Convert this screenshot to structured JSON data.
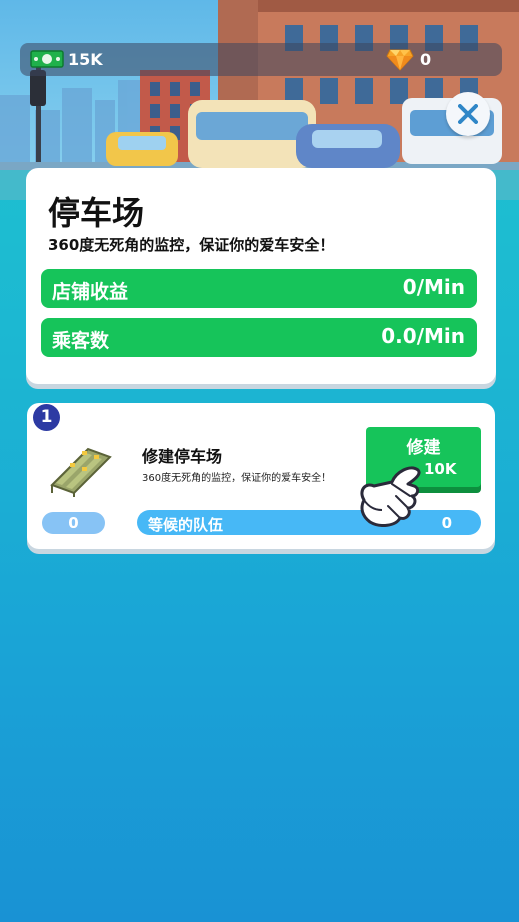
{
  "currency": {
    "cash_icon": "cash-bill-icon",
    "cash": "15K",
    "gem_icon": "diamond-icon",
    "gems": "0"
  },
  "close_icon": "close-icon",
  "info": {
    "title": "停车场",
    "description": "360度无死角的监控，保证你的爱车安全！",
    "stats": [
      {
        "label": "店铺收益",
        "value": "0/Min"
      },
      {
        "label": "乘客数",
        "value": "0.0/Min"
      }
    ]
  },
  "build": {
    "level": "1",
    "icon": "parking-lot-icon",
    "count": "0",
    "name": "修建停车场",
    "description": "360度无死角的监控，保证你的爱车安全！",
    "queue_label": "等候的队伍",
    "queue_value": "0",
    "button_label": "修建",
    "button_cost": "10K",
    "pointer_icon": "pointing-hand-icon"
  },
  "colors": {
    "accent_green": "#16c45a",
    "queue_blue": "#47b8f6",
    "badge_navy": "#2d3aa3",
    "close_blue": "#2f86c7"
  }
}
